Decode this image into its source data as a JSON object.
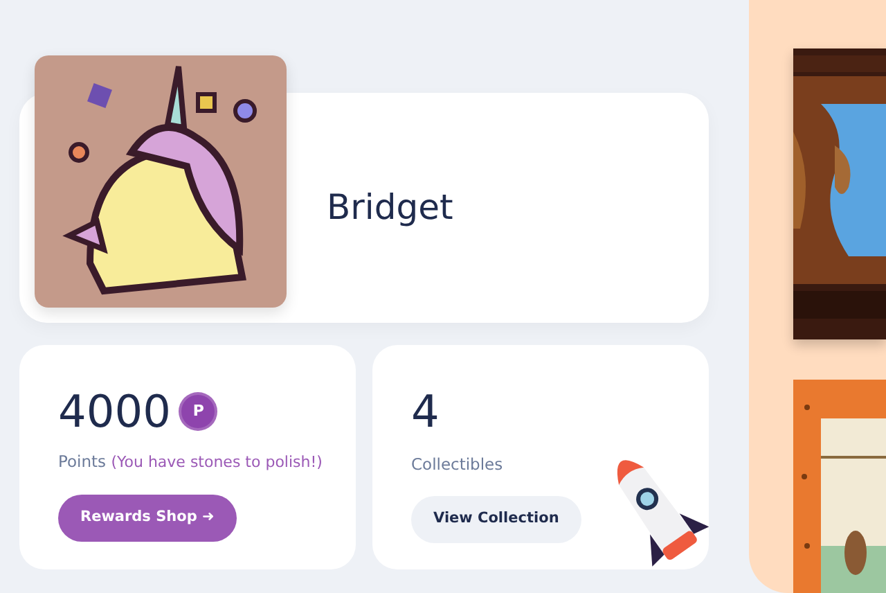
{
  "profile": {
    "name": "Bridget"
  },
  "points": {
    "value": "4000",
    "badge": "P",
    "label": "Points",
    "note": "(You have stones to polish!)",
    "button": "Rewards Shop ➜"
  },
  "collectibles": {
    "value": "4",
    "label": "Collectibles",
    "button": "View Collection"
  }
}
